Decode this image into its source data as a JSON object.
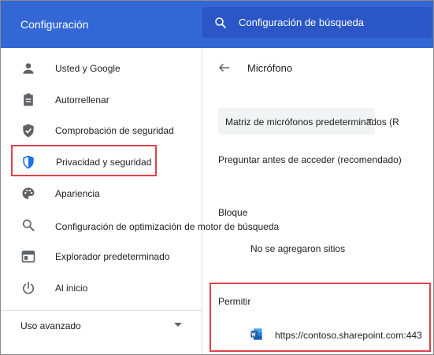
{
  "header": {
    "title": "Configuración",
    "search_placeholder": "Configuración de búsqueda"
  },
  "sidebar": {
    "items": [
      {
        "label": "Usted y Google",
        "icon": "person-icon"
      },
      {
        "label": "Autorrellenar",
        "icon": "clipboard-icon"
      },
      {
        "label": "Comprobación de seguridad",
        "icon": "shield-check-icon"
      },
      {
        "label": "Privacidad y seguridad",
        "icon": "shield-icon",
        "selected": true
      },
      {
        "label": "Apariencia",
        "icon": "palette-icon"
      },
      {
        "label": "Configuración de optimización de motor de búsqueda",
        "icon": "search-icon"
      },
      {
        "label": "Explorador predeterminado",
        "icon": "browser-icon"
      },
      {
        "label": "Al inicio",
        "icon": "power-icon"
      }
    ],
    "advanced_label": "Uso avanzado"
  },
  "main": {
    "title": "Micrófono",
    "device_select_value": "Matriz de micrófonos predeterminados (R",
    "ask_label": "Preguntar antes de acceder (recomendado)",
    "block": {
      "heading": "Bloque",
      "empty_text": "No se agregaron sitios"
    },
    "allow": {
      "heading": "Permitir",
      "sites": [
        {
          "url": "https://contoso.sharepoint.com:443",
          "icon": "word-icon"
        }
      ]
    }
  },
  "colors": {
    "header_bg": "#3367d6",
    "search_bg": "#2a56c6",
    "highlight_border": "#e0414a",
    "icon_gray": "#5f6368",
    "selected_icon_blue": "#1a73e8",
    "word_blue": "#2b579a"
  }
}
